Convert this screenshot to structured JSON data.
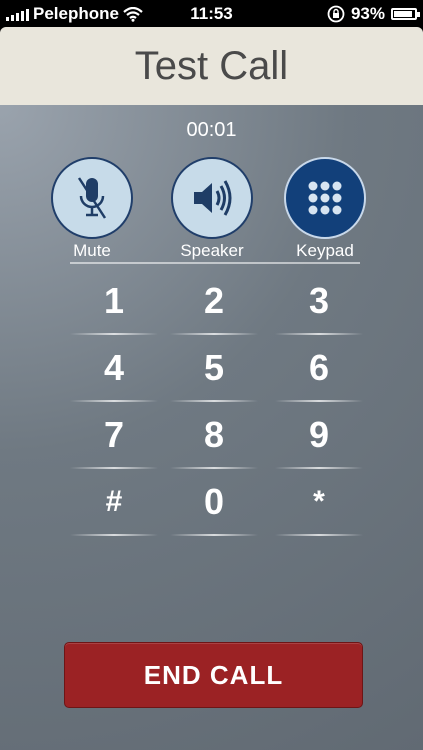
{
  "status_bar": {
    "carrier": "Pelephone",
    "time": "11:53",
    "battery": "93%",
    "battery_level": 0.93
  },
  "header": {
    "title": "Test Call"
  },
  "call": {
    "duration": "00:01"
  },
  "controls": [
    {
      "label": "Mute",
      "icon": "mic-muted-icon",
      "active": false
    },
    {
      "label": "Speaker",
      "icon": "speaker-icon",
      "active": false
    },
    {
      "label": "Keypad",
      "icon": "keypad-icon",
      "active": true
    }
  ],
  "keypad": [
    "1",
    "2",
    "3",
    "4",
    "5",
    "6",
    "7",
    "8",
    "9",
    "#",
    "0",
    "*"
  ],
  "end_call": {
    "label": "END CALL"
  },
  "colors": {
    "title_bar": "#e9e6dc",
    "control_bg": "#c7dbe9",
    "control_active": "#12407a",
    "end_call": "#9b2224"
  }
}
